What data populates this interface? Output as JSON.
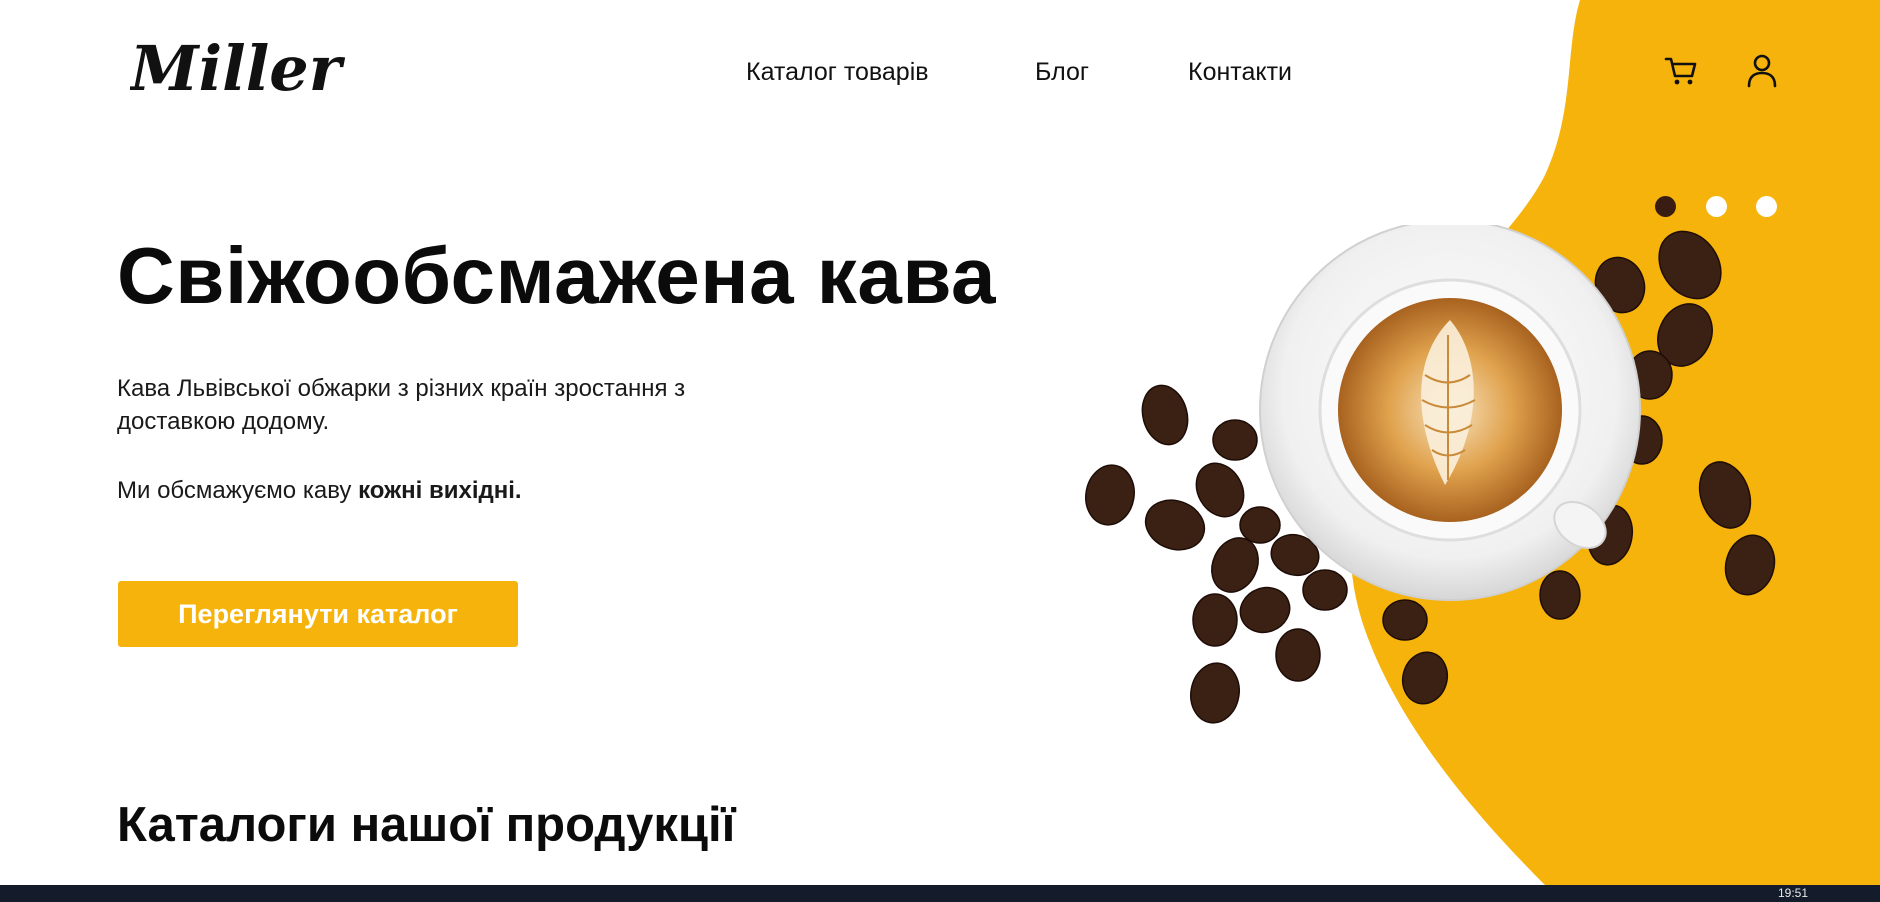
{
  "brand": {
    "logo_text": "Miller"
  },
  "nav": {
    "items": [
      {
        "label": "Каталог товарів"
      },
      {
        "label": "Блог"
      },
      {
        "label": "Контакти"
      }
    ]
  },
  "header_icons": {
    "cart": "cart-icon",
    "user": "user-icon"
  },
  "slider": {
    "slides": 3,
    "active_index": 0
  },
  "hero": {
    "title": "Свіжообсмажена кава",
    "description": "Кава Львівської обжарки з різних країн зростання з доставкою додому.",
    "note_prefix": "Ми обсмажуємо каву ",
    "note_bold": "кожні вихідні.",
    "cta_label": "Переглянути каталог"
  },
  "catalog_section": {
    "title": "Каталоги нашої продукції"
  },
  "taskbar": {
    "clock": "19:51"
  },
  "colors": {
    "accent": "#f6b30b",
    "dot_active": "#3a1d12",
    "dot_inactive": "#ffffff",
    "text": "#0b0b0b",
    "taskbar": "#141c2b"
  }
}
